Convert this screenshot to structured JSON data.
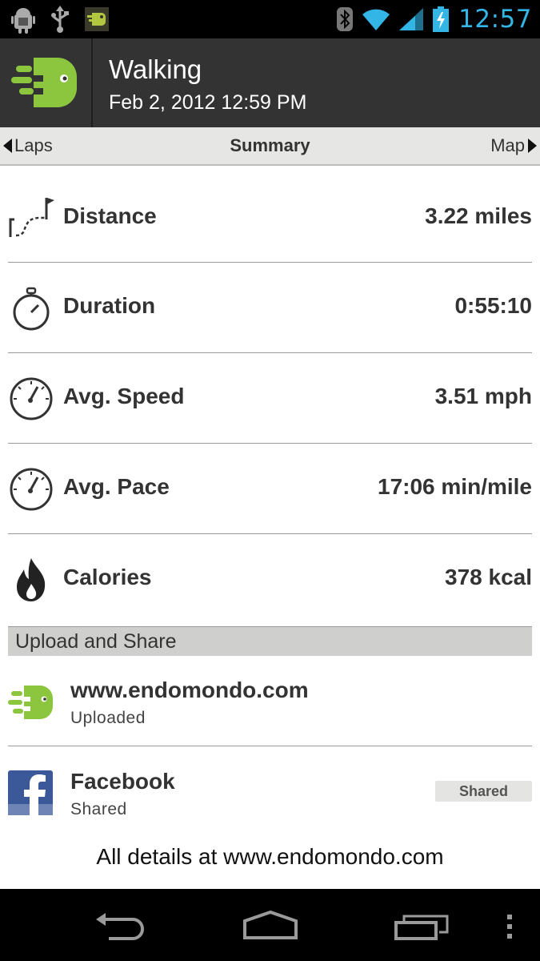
{
  "status_bar": {
    "time": "12:57",
    "icons": [
      "android-debug-icon",
      "usb-icon",
      "endomondo-notification-icon",
      "bluetooth-icon",
      "wifi-icon",
      "signal-icon",
      "battery-charging-icon"
    ]
  },
  "action_bar": {
    "title": "Walking",
    "subtitle": "Feb 2, 2012 12:59 PM"
  },
  "tabs": {
    "prev": "Laps",
    "current": "Summary",
    "next": "Map"
  },
  "stats": [
    {
      "label": "Distance",
      "value": "3.22 miles",
      "icon": "route-flag-icon"
    },
    {
      "label": "Duration",
      "value": "0:55:10",
      "icon": "stopwatch-icon"
    },
    {
      "label": "Avg. Speed",
      "value": "3.51 mph",
      "icon": "speedometer-icon"
    },
    {
      "label": "Avg. Pace",
      "value": "17:06 min/mile",
      "icon": "speedometer-icon"
    },
    {
      "label": "Calories",
      "value": "378 kcal",
      "icon": "flame-icon"
    }
  ],
  "upload_section": {
    "title": "Upload and Share",
    "items": [
      {
        "title": "www.endomondo.com",
        "status": "Uploaded"
      },
      {
        "title": "Facebook",
        "status": "Shared",
        "button": "Shared"
      }
    ]
  },
  "footer": "All details at www.endomondo.com",
  "colors": {
    "accent_blue": "#33b5e5",
    "endomondo_green": "#8cc63f",
    "facebook_blue": "#3b5998"
  }
}
